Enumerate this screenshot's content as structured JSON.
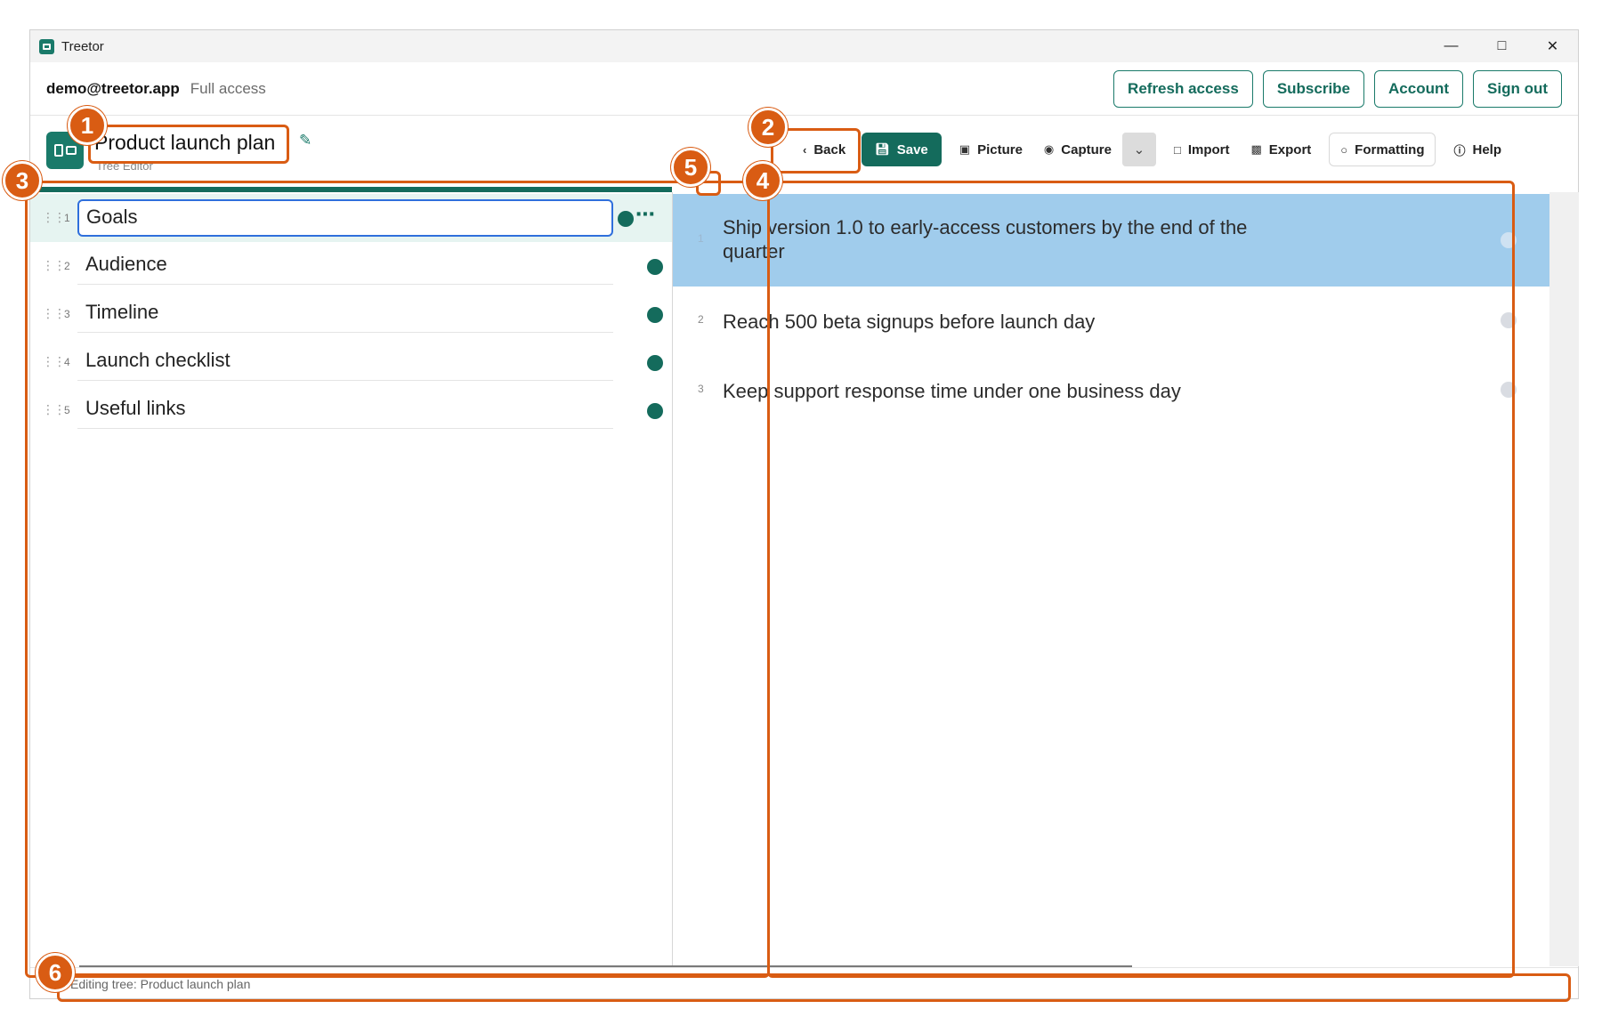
{
  "window": {
    "app_title": "Treetor",
    "controls": [
      "—",
      "□",
      "✕"
    ]
  },
  "account": {
    "email": "demo@treetor.app",
    "access": "Full access",
    "buttons": [
      "Refresh access",
      "Subscribe",
      "Account",
      "Sign out"
    ]
  },
  "doc": {
    "title": "Product launch plan",
    "subtitle": "Tree Editor"
  },
  "toolbar": {
    "back": "Back",
    "save": "Save",
    "picture": "Picture",
    "capture": "Capture",
    "import": "Import",
    "export": "Export",
    "formatting": "Formatting",
    "help": "Help"
  },
  "tree": {
    "items": [
      {
        "num": "1",
        "label": "Goals"
      },
      {
        "num": "2",
        "label": "Audience"
      },
      {
        "num": "3",
        "label": "Timeline"
      },
      {
        "num": "4",
        "label": "Launch checklist"
      },
      {
        "num": "5",
        "label": "Useful links"
      }
    ],
    "more": "⋯"
  },
  "detail": {
    "items": [
      {
        "num": "1",
        "text": "Ship version 1.0 to early-access customers by the end of the quarter"
      },
      {
        "num": "2",
        "text": "Reach 500 beta signups before launch day"
      },
      {
        "num": "3",
        "text": "Keep support response time under one business day"
      }
    ]
  },
  "status": {
    "text": "Editing tree: Product launch plan"
  },
  "callouts": [
    "1",
    "2",
    "3",
    "4",
    "5",
    "6"
  ],
  "colors": {
    "accent": "#146b5c",
    "callout": "#d95c13",
    "selected_row": "#a0ccec"
  }
}
